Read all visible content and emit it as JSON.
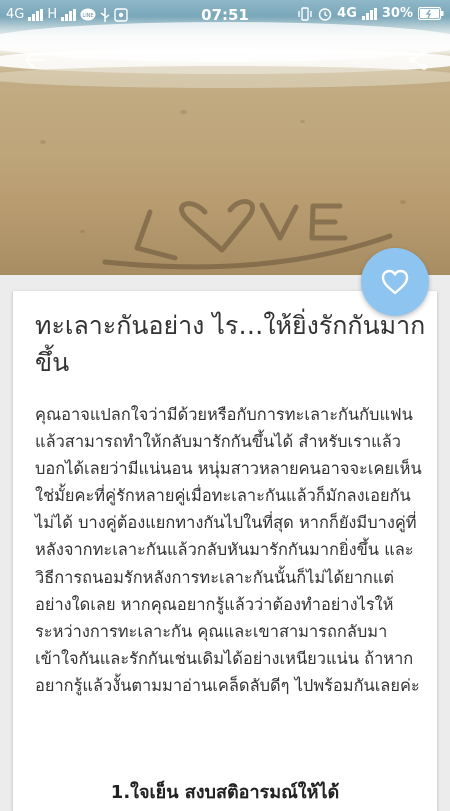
{
  "status_bar": {
    "network_left": "4G",
    "network_h": "H",
    "time": "07:51",
    "network_right": "4G",
    "battery": "30%"
  },
  "article": {
    "title": "ทะเลาะกันอย่าง ไร…ให้ยิ่งรักกันมากขึ้น",
    "body": "คุณอาจแปลกใจว่ามีด้วยหรือกับการทะเลาะกันกับแฟนแล้วสามารถทำให้กลับมารักกันขึ้นได้ สำหรับเราแล้วบอกได้เลยว่ามีแน่นอน หนุ่มสาวหลายคนอาจจะเคยเห็นใช่มั้ยคะที่คู่รักหลายคู่เมื่อทะเลาะกันแล้วก็มักลงเอยกันไม่ได้ บางคู่ต้องแยกทางกันไปในที่สุด หากก็ยังมีบางคู่ที่หลังจากทะเลาะกันแล้วกลับหันมารักกันมากยิ่งขึ้น และวิธีการถนอมรักหลังการทะเลาะกันนั้นก็ไม่ได้ยากแต่อย่างใดเลย หากคุณอยากรู้แล้วว่าต้องทำอย่างไรให้ระหว่างการทะเลาะกัน คุณและเขาสามารถกลับมาเข้าใจกันและรักกันเช่นเดิมได้อย่างเหนียวแน่น ถ้าหากอยากรู้แล้วงั้นตามมาอ่านเคล็ดลับดีๆ ไปพร้อมกันเลยค่ะ",
    "subheading": "1.ใจเย็น สงบสติอารมณ์ให้ได้"
  },
  "icons": {
    "back": "back-arrow-icon",
    "share": "share-icon",
    "favorite": "heart-outline-icon"
  },
  "colors": {
    "fab": "#8ec5f0",
    "text": "#333333"
  }
}
